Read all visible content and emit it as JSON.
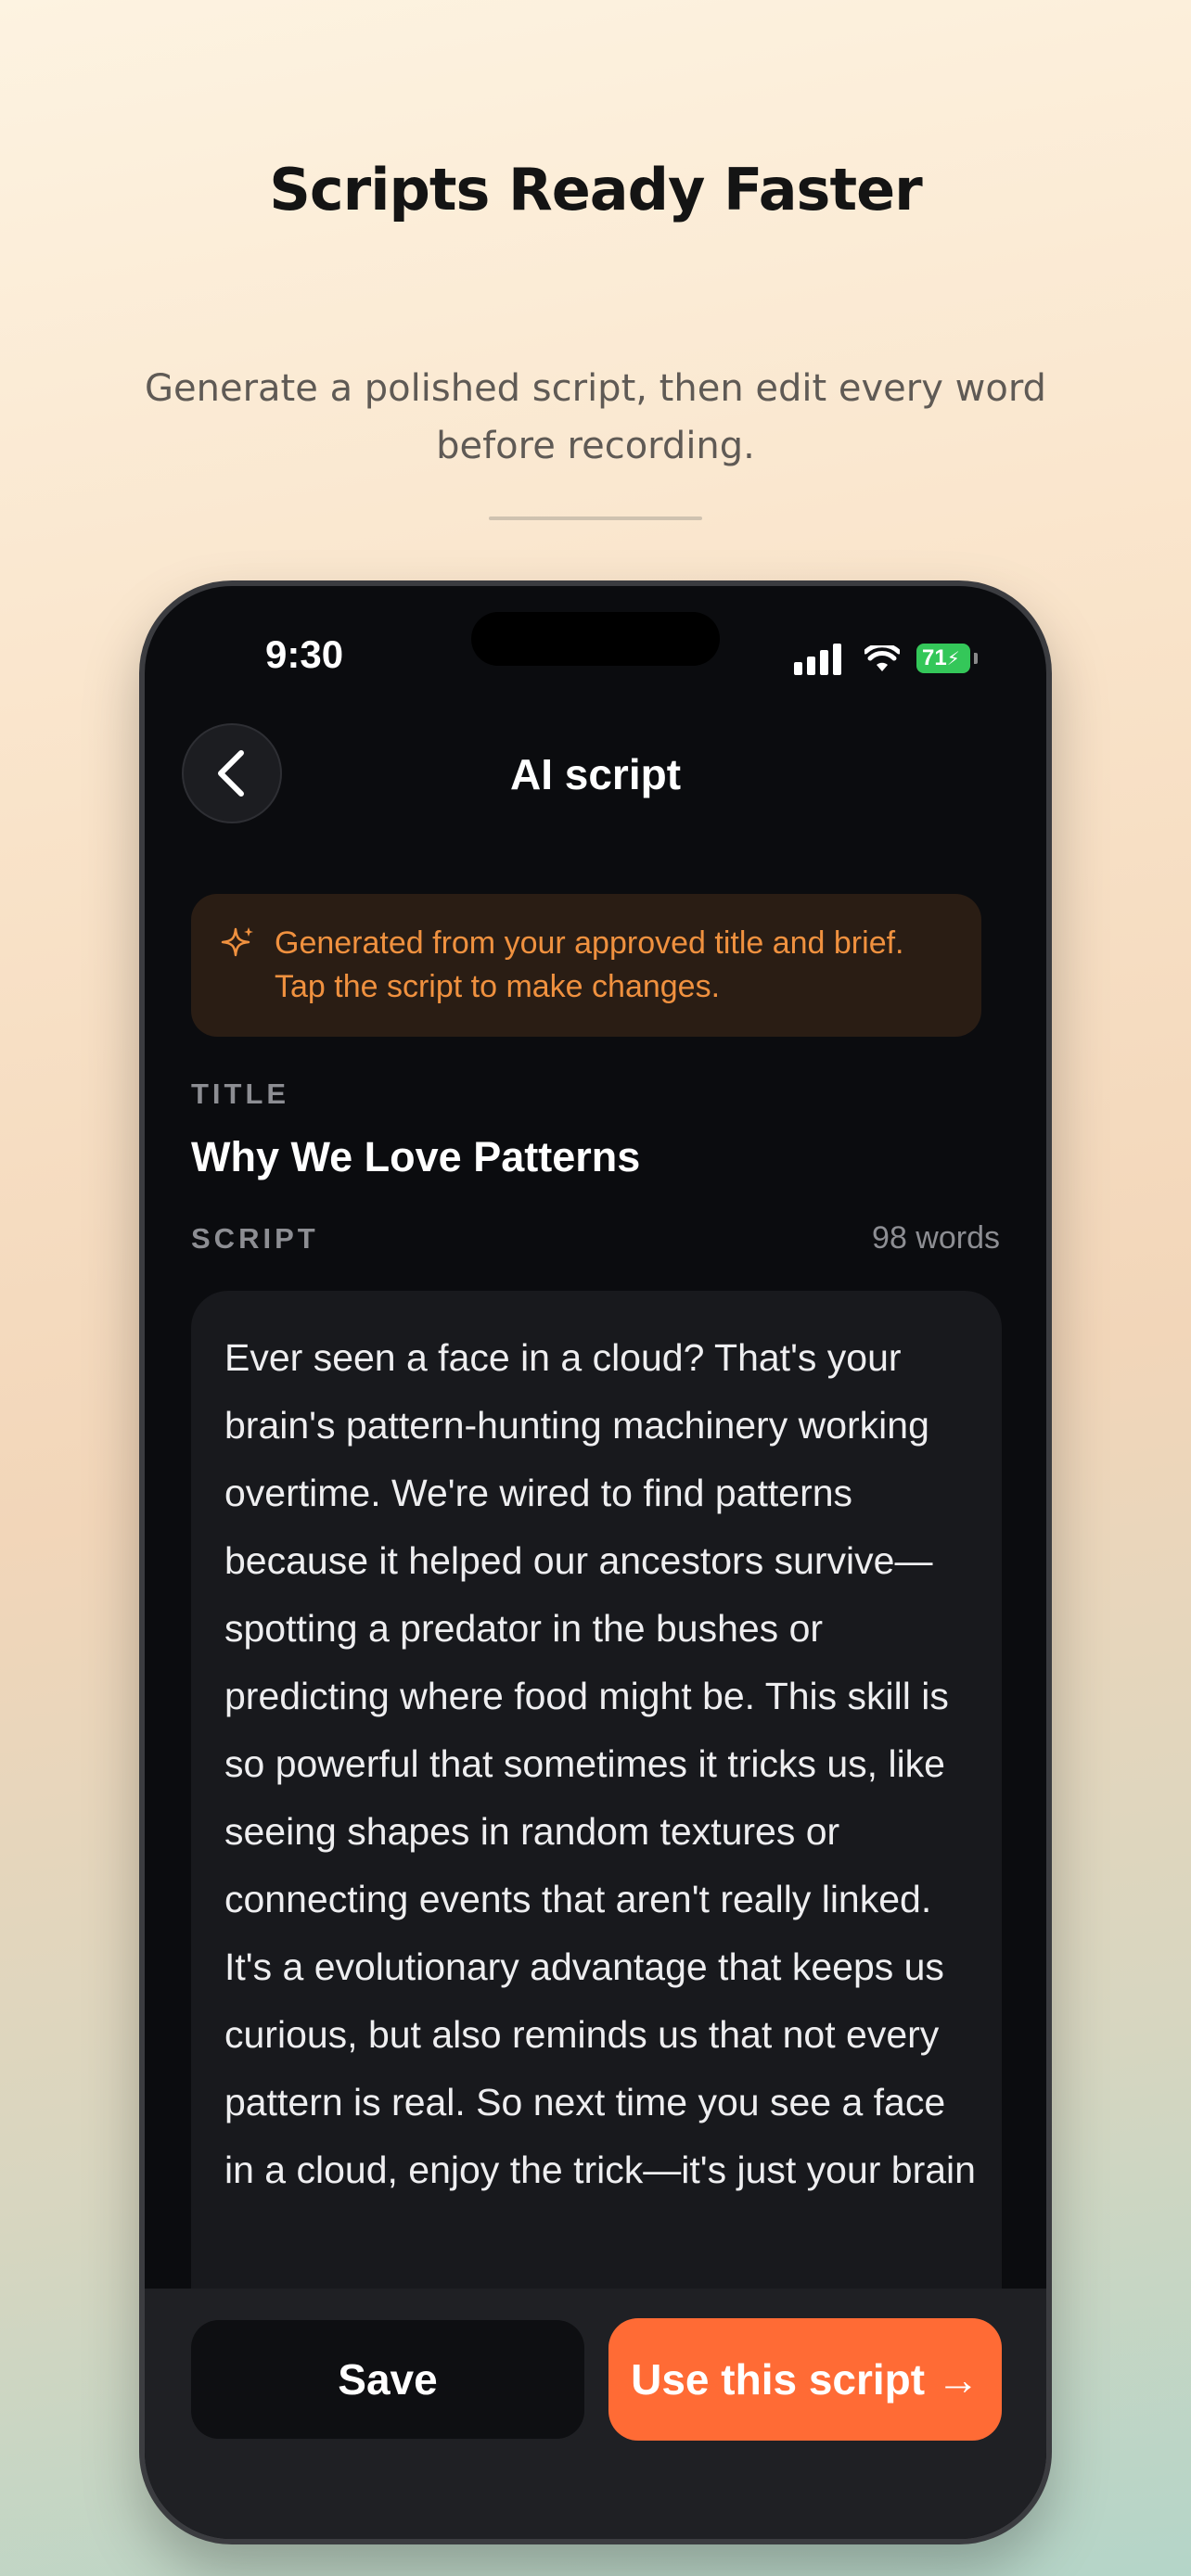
{
  "page": {
    "headline": "Scripts Ready Faster",
    "subheadline": "Generate a polished script, then edit every word before recording."
  },
  "status_bar": {
    "time": "9:30",
    "battery": "71",
    "icons": [
      "signal-icon",
      "wifi-icon",
      "battery-charging-icon"
    ]
  },
  "nav": {
    "back_icon": "chevron-left-icon",
    "title": "AI script"
  },
  "notice": {
    "icon": "sparkle-icon",
    "line1": "Generated from your approved title and brief.",
    "line2": "Tap the script to make changes."
  },
  "title_section": {
    "label": "TITLE",
    "value": "Why We Love Patterns"
  },
  "script_section": {
    "label": "SCRIPT",
    "word_count": "98 words",
    "text": "Ever seen a face in a cloud? That's your brain's pattern-hunting machinery working overtime. We're wired to find patterns because it helped our ancestors survive—spotting a predator in the bushes or predicting where food might be. This skill is so powerful that sometimes it tricks us, like seeing shapes in random textures or connecting events that aren't really linked. It's a evolutionary advantage that keeps us curious, but also reminds us that not every pattern is real. So next time you see a face in a cloud, enjoy the trick—it's just your brain"
  },
  "actions": {
    "save_label": "Save",
    "use_label": "Use this script →"
  },
  "colors": {
    "accent": "#ff6b35",
    "notice_text": "#f0913f",
    "screen_bg": "#0b0c0f",
    "card_bg": "#18191d",
    "battery": "#34c759"
  }
}
